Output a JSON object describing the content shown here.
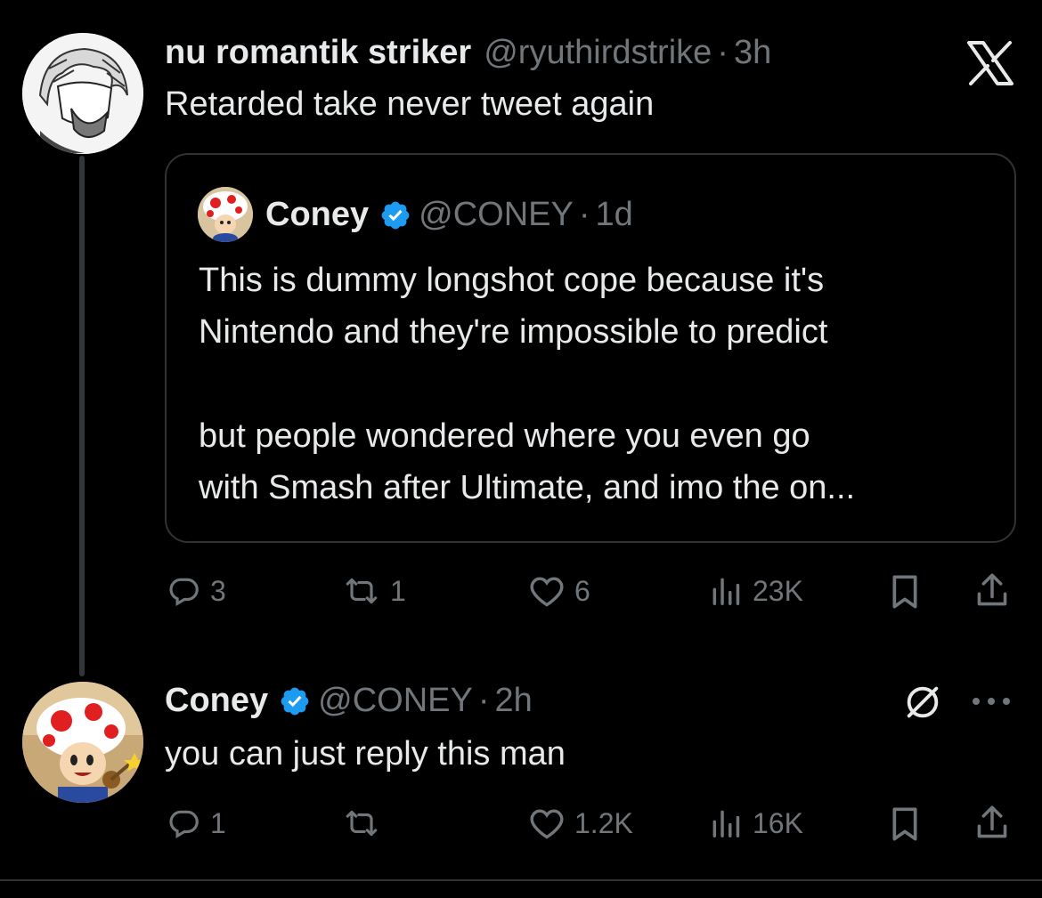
{
  "tweet": {
    "display_name": "nu romantik striker",
    "handle": "@ryuthirdstrike",
    "dot": "·",
    "time": "3h",
    "text": "Retarded take never tweet again"
  },
  "quoted": {
    "display_name": "Coney",
    "handle": "@CONEY",
    "dot": "·",
    "time": "1d",
    "lines": [
      "This is dummy longshot cope because it's",
      "Nintendo and they're impossible to predict",
      "",
      "but people wondered where you even go",
      "with Smash after Ultimate, and imo the on..."
    ]
  },
  "tweet_actions": {
    "replies": "3",
    "reposts": "1",
    "likes": "6",
    "views": "23K"
  },
  "reply": {
    "display_name": "Coney",
    "handle": "@CONEY",
    "dot": "·",
    "time": "2h",
    "text": "you can just reply this man"
  },
  "reply_actions": {
    "replies": "1",
    "reposts": "",
    "likes": "1.2K",
    "views": "16K"
  },
  "colors": {
    "background": "#000000",
    "text": "#e7e9ea",
    "muted": "#71767b",
    "verified": "#1d9bf0",
    "border": "#2f3336"
  },
  "icons": [
    "x-logo-icon",
    "verified-badge-icon",
    "reply-icon",
    "repost-icon",
    "like-icon",
    "views-icon",
    "bookmark-icon",
    "share-icon",
    "muted-slash-icon",
    "more-icon"
  ]
}
